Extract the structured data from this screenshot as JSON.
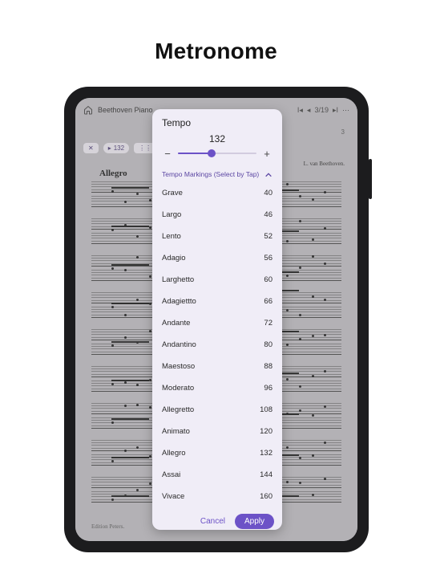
{
  "page_title": "Metronome",
  "background": {
    "piece_title": "Beethoven Piano ",
    "page_indicator": "3/19",
    "sheet_corner": "3",
    "composer": "L. van Beethoven.",
    "tempo_marking": "Allegro",
    "toolbar_bpm": "132",
    "edition": "Edition Peters."
  },
  "modal": {
    "title": "Tempo",
    "value": "132",
    "minus": "−",
    "plus": "+",
    "markings_label": "Tempo Markings (Select by Tap)",
    "items": [
      {
        "label": "Grave",
        "bpm": "40"
      },
      {
        "label": "Largo",
        "bpm": "46"
      },
      {
        "label": "Lento",
        "bpm": "52"
      },
      {
        "label": "Adagio",
        "bpm": "56"
      },
      {
        "label": "Larghetto",
        "bpm": "60"
      },
      {
        "label": "Adagiettto",
        "bpm": "66"
      },
      {
        "label": "Andante",
        "bpm": "72"
      },
      {
        "label": "Andantino",
        "bpm": "80"
      },
      {
        "label": "Maestoso",
        "bpm": "88"
      },
      {
        "label": "Moderato",
        "bpm": "96"
      },
      {
        "label": "Allegretto",
        "bpm": "108"
      },
      {
        "label": "Animato",
        "bpm": "120"
      },
      {
        "label": "Allegro",
        "bpm": "132"
      },
      {
        "label": "Assai",
        "bpm": "144"
      },
      {
        "label": "Vivace",
        "bpm": "160"
      }
    ],
    "cancel": "Cancel",
    "apply": "Apply"
  },
  "colors": {
    "accent": "#6c52c7",
    "modal_bg": "#f0edf7",
    "device": "#1c1c1e"
  }
}
